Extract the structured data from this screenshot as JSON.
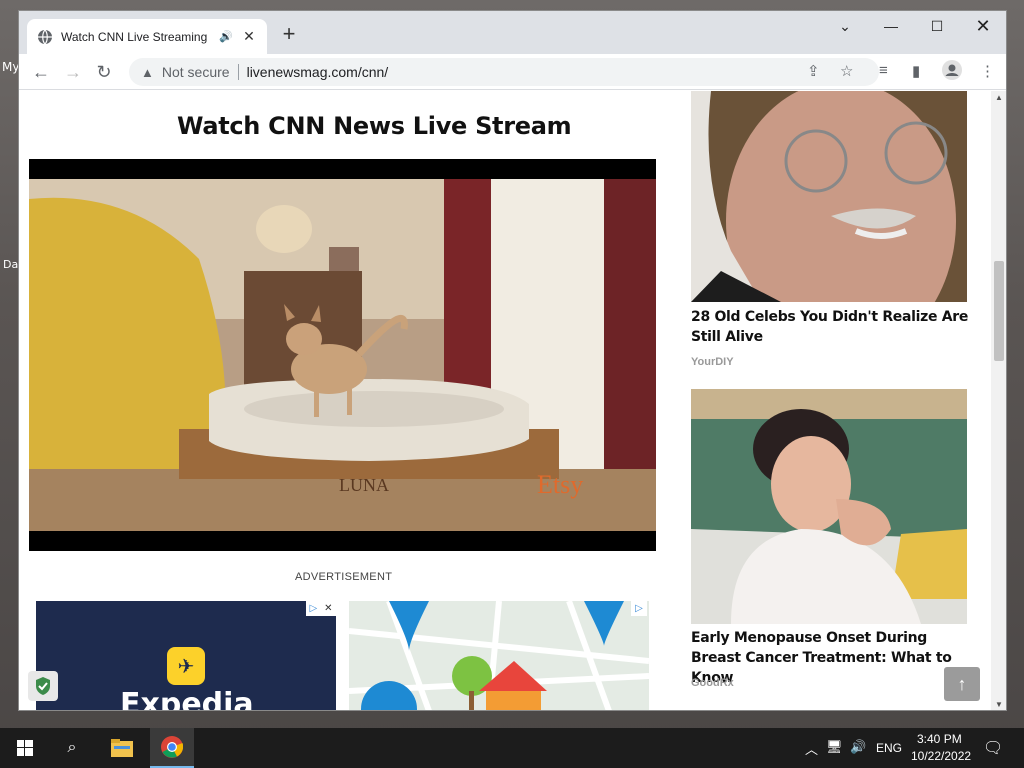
{
  "desktop": {
    "frag1": "My",
    "frag2": "Da"
  },
  "browser": {
    "tab_title": "Watch CNN Live Streaming -",
    "security_label": "Not secure",
    "url": "livenewsmag.com/cnn/"
  },
  "page": {
    "heading": "Watch CNN News Live Stream",
    "video_watermark": "Etsy",
    "video_bed_text": "LUNA",
    "ad_label": "ADVERTISEMENT",
    "ad1_brand": "Expedia",
    "articles": [
      {
        "title": "28 Old Celebs You Didn't Realize Are Still Alive",
        "source": "YourDIY"
      },
      {
        "title": "Early Menopause Onset During Breast Cancer Treatment: What to Know",
        "source": "GoodRx"
      }
    ]
  },
  "taskbar": {
    "language": "ENG",
    "time": "3:40 PM",
    "date": "10/22/2022"
  },
  "colors": {
    "accent_chrome_tab": "#dee1e6",
    "ad1_bg": "#1e2b4e",
    "taskbar": "#1c1c1c"
  }
}
